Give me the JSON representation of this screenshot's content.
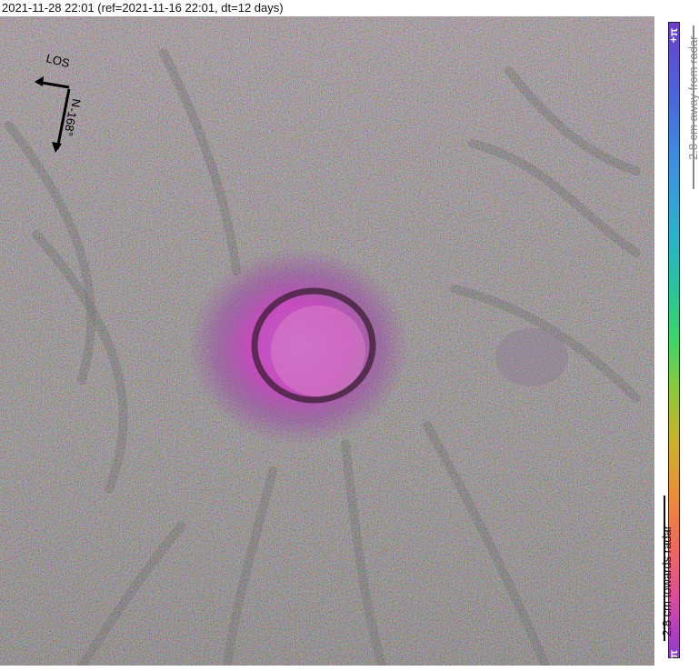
{
  "header": {
    "title": "2021-11-28 22:01 (ref=2021-11-16 22:01, dt=12 days)"
  },
  "compass": {
    "los_label": "LOS",
    "north_label": "N",
    "angle_label": "-168°"
  },
  "colorbar": {
    "top_label": "+π",
    "bottom_label": "−π",
    "away_label": "2.8 cm away from radar",
    "towards_label": "2.8 cm towards radar"
  }
}
